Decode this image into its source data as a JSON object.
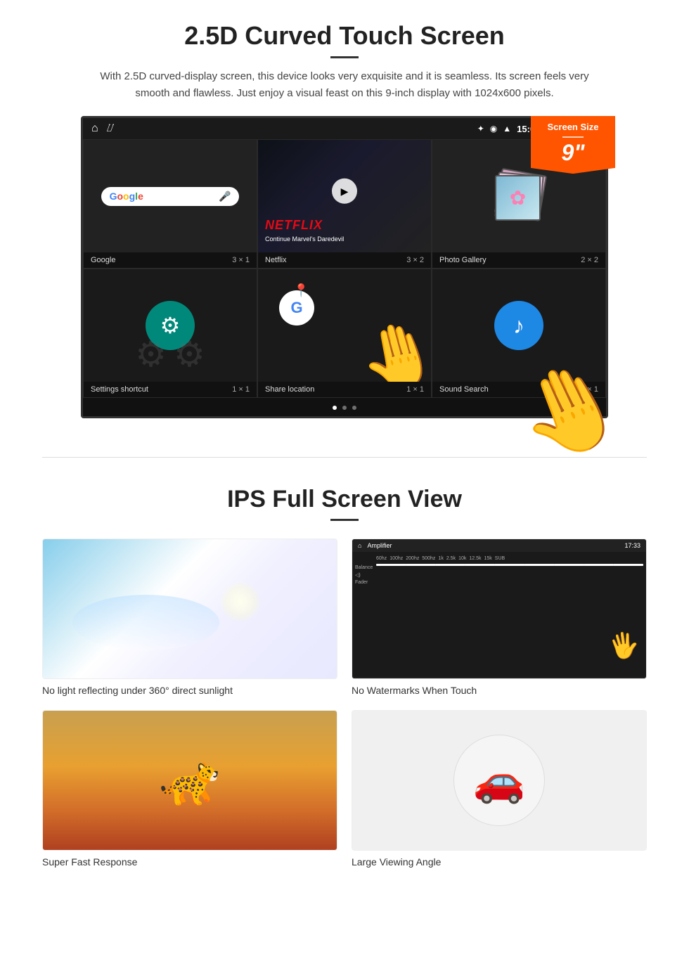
{
  "section1": {
    "title": "2.5D Curved Touch Screen",
    "description": "With 2.5D curved-display screen, this device looks very exquisite and it is seamless. Its screen feels very smooth and flawless. Just enjoy a visual feast on this 9-inch display with 1024x600 pixels.",
    "badge": {
      "label": "Screen Size",
      "size": "9\""
    },
    "statusBar": {
      "time": "15:06"
    },
    "apps": [
      {
        "name": "Google",
        "size": "3 × 1",
        "type": "google"
      },
      {
        "name": "Netflix",
        "size": "3 × 2",
        "type": "netflix",
        "netflix_text": "NETFLIX",
        "netflix_sub": "Continue Marvel's Daredevil"
      },
      {
        "name": "Photo Gallery",
        "size": "2 × 2",
        "type": "gallery"
      },
      {
        "name": "Settings shortcut",
        "size": "1 × 1",
        "type": "settings"
      },
      {
        "name": "Share location",
        "size": "1 × 1",
        "type": "share"
      },
      {
        "name": "Sound Search",
        "size": "1 × 1",
        "type": "sound"
      }
    ]
  },
  "section2": {
    "title": "IPS Full Screen View",
    "features": [
      {
        "caption": "No light reflecting under 360° direct sunlight",
        "type": "sunlight"
      },
      {
        "caption": "No Watermarks When Touch",
        "type": "amplifier"
      },
      {
        "caption": "Super Fast Response",
        "type": "cheetah"
      },
      {
        "caption": "Large Viewing Angle",
        "type": "car"
      }
    ]
  }
}
